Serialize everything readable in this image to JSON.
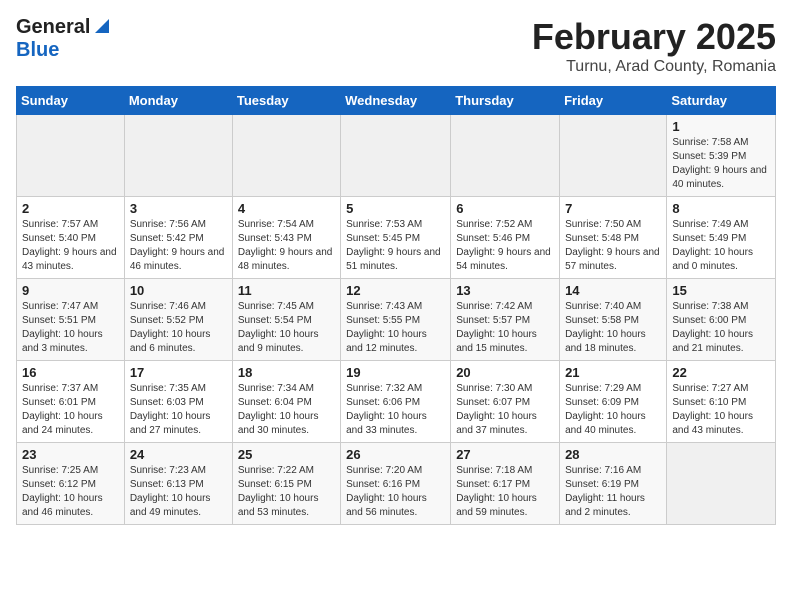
{
  "header": {
    "logo_general": "General",
    "logo_blue": "Blue",
    "month_title": "February 2025",
    "location": "Turnu, Arad County, Romania"
  },
  "weekdays": [
    "Sunday",
    "Monday",
    "Tuesday",
    "Wednesday",
    "Thursday",
    "Friday",
    "Saturday"
  ],
  "weeks": [
    [
      {
        "day": "",
        "info": ""
      },
      {
        "day": "",
        "info": ""
      },
      {
        "day": "",
        "info": ""
      },
      {
        "day": "",
        "info": ""
      },
      {
        "day": "",
        "info": ""
      },
      {
        "day": "",
        "info": ""
      },
      {
        "day": "1",
        "info": "Sunrise: 7:58 AM\nSunset: 5:39 PM\nDaylight: 9 hours and 40 minutes."
      }
    ],
    [
      {
        "day": "2",
        "info": "Sunrise: 7:57 AM\nSunset: 5:40 PM\nDaylight: 9 hours and 43 minutes."
      },
      {
        "day": "3",
        "info": "Sunrise: 7:56 AM\nSunset: 5:42 PM\nDaylight: 9 hours and 46 minutes."
      },
      {
        "day": "4",
        "info": "Sunrise: 7:54 AM\nSunset: 5:43 PM\nDaylight: 9 hours and 48 minutes."
      },
      {
        "day": "5",
        "info": "Sunrise: 7:53 AM\nSunset: 5:45 PM\nDaylight: 9 hours and 51 minutes."
      },
      {
        "day": "6",
        "info": "Sunrise: 7:52 AM\nSunset: 5:46 PM\nDaylight: 9 hours and 54 minutes."
      },
      {
        "day": "7",
        "info": "Sunrise: 7:50 AM\nSunset: 5:48 PM\nDaylight: 9 hours and 57 minutes."
      },
      {
        "day": "8",
        "info": "Sunrise: 7:49 AM\nSunset: 5:49 PM\nDaylight: 10 hours and 0 minutes."
      }
    ],
    [
      {
        "day": "9",
        "info": "Sunrise: 7:47 AM\nSunset: 5:51 PM\nDaylight: 10 hours and 3 minutes."
      },
      {
        "day": "10",
        "info": "Sunrise: 7:46 AM\nSunset: 5:52 PM\nDaylight: 10 hours and 6 minutes."
      },
      {
        "day": "11",
        "info": "Sunrise: 7:45 AM\nSunset: 5:54 PM\nDaylight: 10 hours and 9 minutes."
      },
      {
        "day": "12",
        "info": "Sunrise: 7:43 AM\nSunset: 5:55 PM\nDaylight: 10 hours and 12 minutes."
      },
      {
        "day": "13",
        "info": "Sunrise: 7:42 AM\nSunset: 5:57 PM\nDaylight: 10 hours and 15 minutes."
      },
      {
        "day": "14",
        "info": "Sunrise: 7:40 AM\nSunset: 5:58 PM\nDaylight: 10 hours and 18 minutes."
      },
      {
        "day": "15",
        "info": "Sunrise: 7:38 AM\nSunset: 6:00 PM\nDaylight: 10 hours and 21 minutes."
      }
    ],
    [
      {
        "day": "16",
        "info": "Sunrise: 7:37 AM\nSunset: 6:01 PM\nDaylight: 10 hours and 24 minutes."
      },
      {
        "day": "17",
        "info": "Sunrise: 7:35 AM\nSunset: 6:03 PM\nDaylight: 10 hours and 27 minutes."
      },
      {
        "day": "18",
        "info": "Sunrise: 7:34 AM\nSunset: 6:04 PM\nDaylight: 10 hours and 30 minutes."
      },
      {
        "day": "19",
        "info": "Sunrise: 7:32 AM\nSunset: 6:06 PM\nDaylight: 10 hours and 33 minutes."
      },
      {
        "day": "20",
        "info": "Sunrise: 7:30 AM\nSunset: 6:07 PM\nDaylight: 10 hours and 37 minutes."
      },
      {
        "day": "21",
        "info": "Sunrise: 7:29 AM\nSunset: 6:09 PM\nDaylight: 10 hours and 40 minutes."
      },
      {
        "day": "22",
        "info": "Sunrise: 7:27 AM\nSunset: 6:10 PM\nDaylight: 10 hours and 43 minutes."
      }
    ],
    [
      {
        "day": "23",
        "info": "Sunrise: 7:25 AM\nSunset: 6:12 PM\nDaylight: 10 hours and 46 minutes."
      },
      {
        "day": "24",
        "info": "Sunrise: 7:23 AM\nSunset: 6:13 PM\nDaylight: 10 hours and 49 minutes."
      },
      {
        "day": "25",
        "info": "Sunrise: 7:22 AM\nSunset: 6:15 PM\nDaylight: 10 hours and 53 minutes."
      },
      {
        "day": "26",
        "info": "Sunrise: 7:20 AM\nSunset: 6:16 PM\nDaylight: 10 hours and 56 minutes."
      },
      {
        "day": "27",
        "info": "Sunrise: 7:18 AM\nSunset: 6:17 PM\nDaylight: 10 hours and 59 minutes."
      },
      {
        "day": "28",
        "info": "Sunrise: 7:16 AM\nSunset: 6:19 PM\nDaylight: 11 hours and 2 minutes."
      },
      {
        "day": "",
        "info": ""
      }
    ]
  ]
}
